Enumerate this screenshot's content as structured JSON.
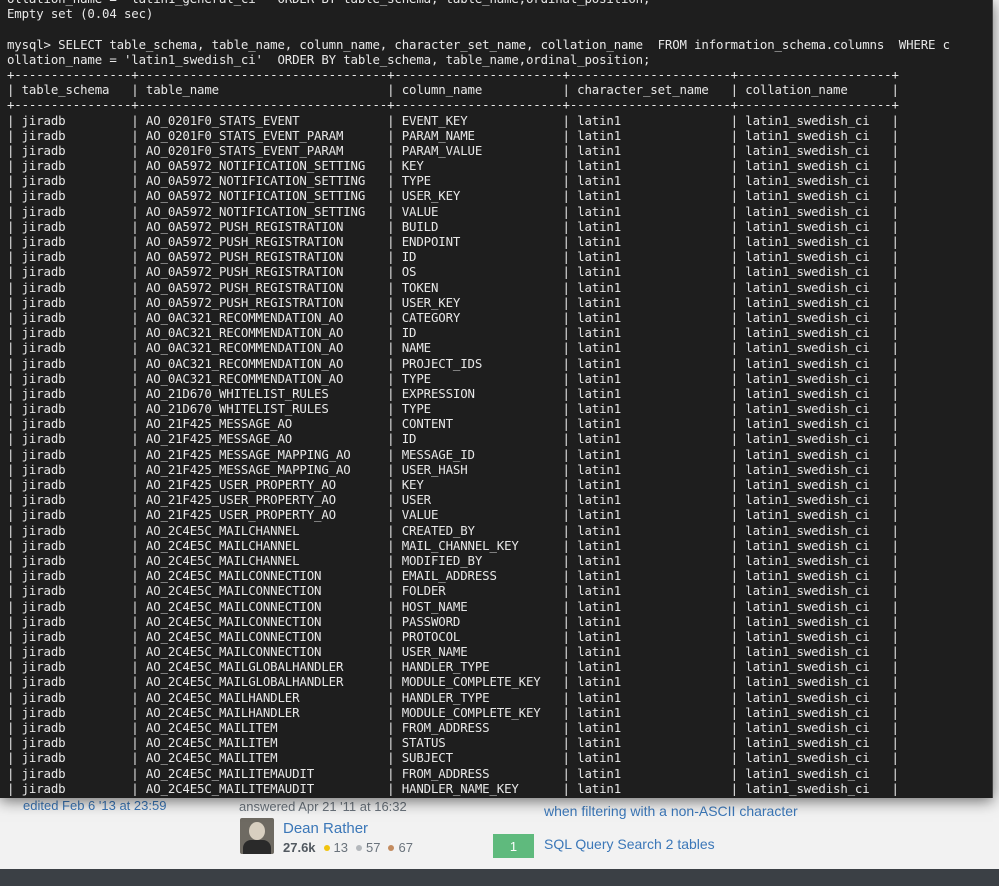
{
  "terminal": {
    "header_lines": [
      "ollation_name = 'latin1_general_ci'  ORDER BY table_schema, table_name,ordinal_position;",
      "Empty set (0.04 sec)",
      "",
      "mysql> SELECT table_schema, table_name, column_name, character_set_name, collation_name  FROM information_schema.columns  WHERE c",
      "ollation_name = 'latin1_swedish_ci'  ORDER BY table_schema, table_name,ordinal_position;"
    ],
    "columns": [
      "table_schema",
      "table_name",
      "column_name",
      "character_set_name",
      "collation_name"
    ],
    "rows": [
      [
        "jiradb",
        "AO_0201F0_STATS_EVENT",
        "EVENT_KEY",
        "latin1",
        "latin1_swedish_ci"
      ],
      [
        "jiradb",
        "AO_0201F0_STATS_EVENT_PARAM",
        "PARAM_NAME",
        "latin1",
        "latin1_swedish_ci"
      ],
      [
        "jiradb",
        "AO_0201F0_STATS_EVENT_PARAM",
        "PARAM_VALUE",
        "latin1",
        "latin1_swedish_ci"
      ],
      [
        "jiradb",
        "AO_0A5972_NOTIFICATION_SETTING",
        "KEY",
        "latin1",
        "latin1_swedish_ci"
      ],
      [
        "jiradb",
        "AO_0A5972_NOTIFICATION_SETTING",
        "TYPE",
        "latin1",
        "latin1_swedish_ci"
      ],
      [
        "jiradb",
        "AO_0A5972_NOTIFICATION_SETTING",
        "USER_KEY",
        "latin1",
        "latin1_swedish_ci"
      ],
      [
        "jiradb",
        "AO_0A5972_NOTIFICATION_SETTING",
        "VALUE",
        "latin1",
        "latin1_swedish_ci"
      ],
      [
        "jiradb",
        "AO_0A5972_PUSH_REGISTRATION",
        "BUILD",
        "latin1",
        "latin1_swedish_ci"
      ],
      [
        "jiradb",
        "AO_0A5972_PUSH_REGISTRATION",
        "ENDPOINT",
        "latin1",
        "latin1_swedish_ci"
      ],
      [
        "jiradb",
        "AO_0A5972_PUSH_REGISTRATION",
        "ID",
        "latin1",
        "latin1_swedish_ci"
      ],
      [
        "jiradb",
        "AO_0A5972_PUSH_REGISTRATION",
        "OS",
        "latin1",
        "latin1_swedish_ci"
      ],
      [
        "jiradb",
        "AO_0A5972_PUSH_REGISTRATION",
        "TOKEN",
        "latin1",
        "latin1_swedish_ci"
      ],
      [
        "jiradb",
        "AO_0A5972_PUSH_REGISTRATION",
        "USER_KEY",
        "latin1",
        "latin1_swedish_ci"
      ],
      [
        "jiradb",
        "AO_0AC321_RECOMMENDATION_AO",
        "CATEGORY",
        "latin1",
        "latin1_swedish_ci"
      ],
      [
        "jiradb",
        "AO_0AC321_RECOMMENDATION_AO",
        "ID",
        "latin1",
        "latin1_swedish_ci"
      ],
      [
        "jiradb",
        "AO_0AC321_RECOMMENDATION_AO",
        "NAME",
        "latin1",
        "latin1_swedish_ci"
      ],
      [
        "jiradb",
        "AO_0AC321_RECOMMENDATION_AO",
        "PROJECT_IDS",
        "latin1",
        "latin1_swedish_ci"
      ],
      [
        "jiradb",
        "AO_0AC321_RECOMMENDATION_AO",
        "TYPE",
        "latin1",
        "latin1_swedish_ci"
      ],
      [
        "jiradb",
        "AO_21D670_WHITELIST_RULES",
        "EXPRESSION",
        "latin1",
        "latin1_swedish_ci"
      ],
      [
        "jiradb",
        "AO_21D670_WHITELIST_RULES",
        "TYPE",
        "latin1",
        "latin1_swedish_ci"
      ],
      [
        "jiradb",
        "AO_21F425_MESSAGE_AO",
        "CONTENT",
        "latin1",
        "latin1_swedish_ci"
      ],
      [
        "jiradb",
        "AO_21F425_MESSAGE_AO",
        "ID",
        "latin1",
        "latin1_swedish_ci"
      ],
      [
        "jiradb",
        "AO_21F425_MESSAGE_MAPPING_AO",
        "MESSAGE_ID",
        "latin1",
        "latin1_swedish_ci"
      ],
      [
        "jiradb",
        "AO_21F425_MESSAGE_MAPPING_AO",
        "USER_HASH",
        "latin1",
        "latin1_swedish_ci"
      ],
      [
        "jiradb",
        "AO_21F425_USER_PROPERTY_AO",
        "KEY",
        "latin1",
        "latin1_swedish_ci"
      ],
      [
        "jiradb",
        "AO_21F425_USER_PROPERTY_AO",
        "USER",
        "latin1",
        "latin1_swedish_ci"
      ],
      [
        "jiradb",
        "AO_21F425_USER_PROPERTY_AO",
        "VALUE",
        "latin1",
        "latin1_swedish_ci"
      ],
      [
        "jiradb",
        "AO_2C4E5C_MAILCHANNEL",
        "CREATED_BY",
        "latin1",
        "latin1_swedish_ci"
      ],
      [
        "jiradb",
        "AO_2C4E5C_MAILCHANNEL",
        "MAIL_CHANNEL_KEY",
        "latin1",
        "latin1_swedish_ci"
      ],
      [
        "jiradb",
        "AO_2C4E5C_MAILCHANNEL",
        "MODIFIED_BY",
        "latin1",
        "latin1_swedish_ci"
      ],
      [
        "jiradb",
        "AO_2C4E5C_MAILCONNECTION",
        "EMAIL_ADDRESS",
        "latin1",
        "latin1_swedish_ci"
      ],
      [
        "jiradb",
        "AO_2C4E5C_MAILCONNECTION",
        "FOLDER",
        "latin1",
        "latin1_swedish_ci"
      ],
      [
        "jiradb",
        "AO_2C4E5C_MAILCONNECTION",
        "HOST_NAME",
        "latin1",
        "latin1_swedish_ci"
      ],
      [
        "jiradb",
        "AO_2C4E5C_MAILCONNECTION",
        "PASSWORD",
        "latin1",
        "latin1_swedish_ci"
      ],
      [
        "jiradb",
        "AO_2C4E5C_MAILCONNECTION",
        "PROTOCOL",
        "latin1",
        "latin1_swedish_ci"
      ],
      [
        "jiradb",
        "AO_2C4E5C_MAILCONNECTION",
        "USER_NAME",
        "latin1",
        "latin1_swedish_ci"
      ],
      [
        "jiradb",
        "AO_2C4E5C_MAILGLOBALHANDLER",
        "HANDLER_TYPE",
        "latin1",
        "latin1_swedish_ci"
      ],
      [
        "jiradb",
        "AO_2C4E5C_MAILGLOBALHANDLER",
        "MODULE_COMPLETE_KEY",
        "latin1",
        "latin1_swedish_ci"
      ],
      [
        "jiradb",
        "AO_2C4E5C_MAILHANDLER",
        "HANDLER_TYPE",
        "latin1",
        "latin1_swedish_ci"
      ],
      [
        "jiradb",
        "AO_2C4E5C_MAILHANDLER",
        "MODULE_COMPLETE_KEY",
        "latin1",
        "latin1_swedish_ci"
      ],
      [
        "jiradb",
        "AO_2C4E5C_MAILITEM",
        "FROM_ADDRESS",
        "latin1",
        "latin1_swedish_ci"
      ],
      [
        "jiradb",
        "AO_2C4E5C_MAILITEM",
        "STATUS",
        "latin1",
        "latin1_swedish_ci"
      ],
      [
        "jiradb",
        "AO_2C4E5C_MAILITEM",
        "SUBJECT",
        "latin1",
        "latin1_swedish_ci"
      ],
      [
        "jiradb",
        "AO_2C4E5C_MAILITEMAUDIT",
        "FROM_ADDRESS",
        "latin1",
        "latin1_swedish_ci"
      ],
      [
        "jiradb",
        "AO_2C4E5C_MAILITEMAUDIT",
        "HANDLER_NAME_KEY",
        "latin1",
        "latin1_swedish_ci"
      ]
    ]
  },
  "page": {
    "edited_text": "edited Feb 6 '13 at 23:59",
    "answered_text": "answered Apr 21 '11 at 16:32",
    "user_name": "Dean Rather",
    "user_rep": "27.6k",
    "gold_count": "13",
    "silver_count": "57",
    "bronze_count": "67",
    "related": [
      {
        "votes": "",
        "title": "when filtering with a non-ASCII character"
      },
      {
        "votes": "1",
        "title": "SQL Query Search 2 tables"
      }
    ]
  }
}
